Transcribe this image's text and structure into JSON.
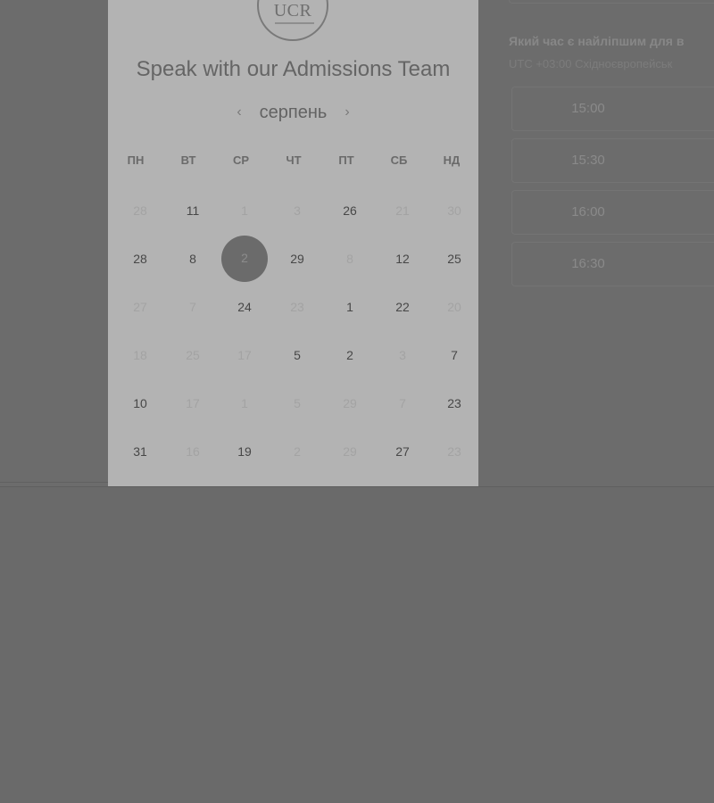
{
  "logo": {
    "text": "UCR"
  },
  "calendar": {
    "title": "Speak with our Admissions Team",
    "month": "серпень",
    "prev_icon": "chevron-left-icon",
    "next_icon": "chevron-right-icon",
    "weekdays": [
      "ПН",
      "ВТ",
      "СР",
      "ЧТ",
      "ПТ",
      "СБ",
      "НД"
    ],
    "weeks": [
      [
        {
          "d": "28",
          "on": false
        },
        {
          "d": "11",
          "on": true
        },
        {
          "d": "1",
          "on": false
        },
        {
          "d": "3",
          "on": false
        },
        {
          "d": "26",
          "on": true
        },
        {
          "d": "21",
          "on": false
        },
        {
          "d": "30",
          "on": false
        }
      ],
      [
        {
          "d": "28",
          "on": true
        },
        {
          "d": "8",
          "on": true
        },
        {
          "d": "2",
          "on": true,
          "selected": true
        },
        {
          "d": "29",
          "on": true
        },
        {
          "d": "8",
          "on": false
        },
        {
          "d": "12",
          "on": true
        },
        {
          "d": "25",
          "on": true
        }
      ],
      [
        {
          "d": "27",
          "on": false
        },
        {
          "d": "7",
          "on": false
        },
        {
          "d": "24",
          "on": true
        },
        {
          "d": "23",
          "on": false
        },
        {
          "d": "1",
          "on": true
        },
        {
          "d": "22",
          "on": true
        },
        {
          "d": "20",
          "on": false
        }
      ],
      [
        {
          "d": "18",
          "on": false
        },
        {
          "d": "25",
          "on": false
        },
        {
          "d": "17",
          "on": false
        },
        {
          "d": "5",
          "on": true
        },
        {
          "d": "2",
          "on": true
        },
        {
          "d": "3",
          "on": false
        },
        {
          "d": "7",
          "on": true
        }
      ],
      [
        {
          "d": "10",
          "on": true
        },
        {
          "d": "17",
          "on": false
        },
        {
          "d": "1",
          "on": false
        },
        {
          "d": "5",
          "on": false
        },
        {
          "d": "29",
          "on": false
        },
        {
          "d": "7",
          "on": false
        },
        {
          "d": "23",
          "on": true
        }
      ],
      [
        {
          "d": "31",
          "on": true
        },
        {
          "d": "16",
          "on": false
        },
        {
          "d": "19",
          "on": true
        },
        {
          "d": "2",
          "on": false
        },
        {
          "d": "29",
          "on": false
        },
        {
          "d": "27",
          "on": true
        },
        {
          "d": "23",
          "on": false
        }
      ]
    ]
  },
  "time_panel": {
    "question": "Який час є найліпшим для в",
    "timezone": "UTC +03:00 Східноєвропейськ",
    "slots": [
      "15:00",
      "15:30",
      "16:00",
      "16:30"
    ]
  }
}
